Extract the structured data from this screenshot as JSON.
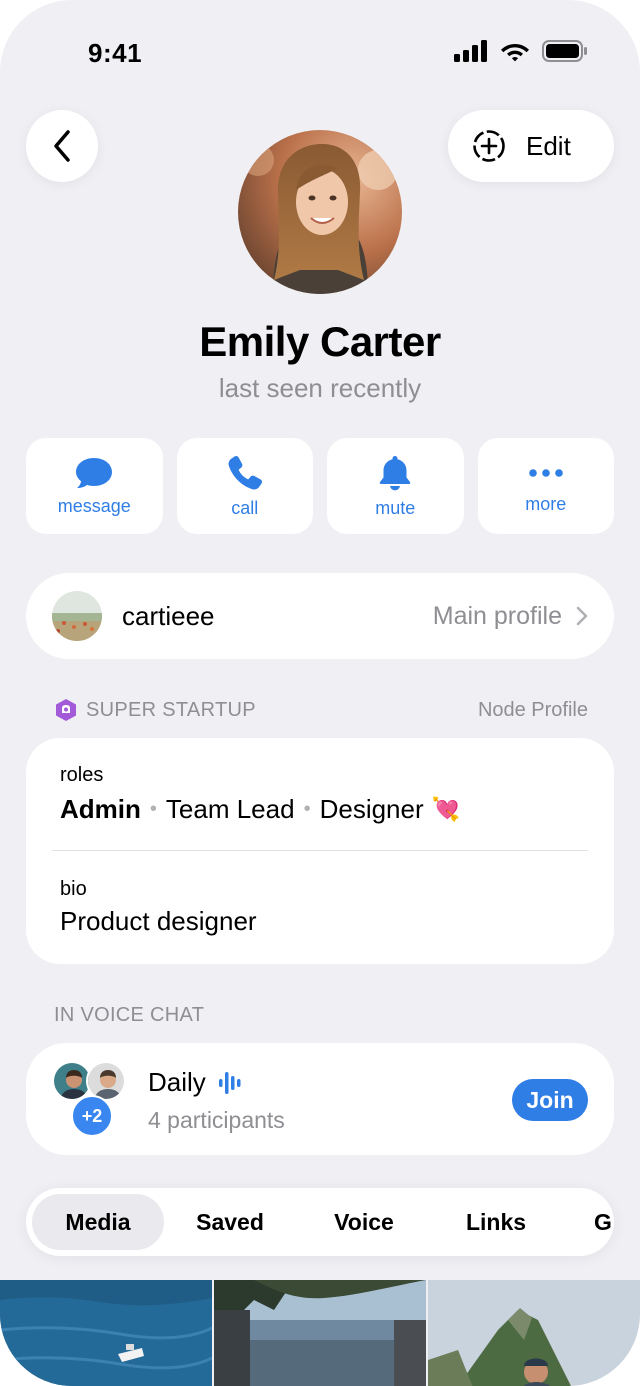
{
  "status_bar": {
    "time": "9:41"
  },
  "header": {
    "edit_label": "Edit"
  },
  "profile": {
    "name": "Emily Carter",
    "status": "last seen recently"
  },
  "actions": [
    {
      "label": "message",
      "icon": "message-bubble-icon"
    },
    {
      "label": "call",
      "icon": "phone-icon"
    },
    {
      "label": "mute",
      "icon": "bell-icon"
    },
    {
      "label": "more",
      "icon": "ellipsis-icon"
    }
  ],
  "main_profile": {
    "username": "cartieee",
    "label": "Main profile"
  },
  "organization": {
    "name": "SUPER STARTUP",
    "link": "Node Profile",
    "roles_label": "roles",
    "roles": [
      "Admin",
      "Team Lead",
      "Designer"
    ],
    "roles_emoji": "💘",
    "bio_label": "bio",
    "bio": "Product designer"
  },
  "voice_chat": {
    "section_title": "IN VOICE CHAT",
    "title": "Daily",
    "participants": "4 participants",
    "extra_count": "+2",
    "join_label": "Join"
  },
  "tabs": [
    "Media",
    "Saved",
    "Voice",
    "Links",
    "G"
  ],
  "active_tab": "Media",
  "colors": {
    "accent": "#2f7ee6",
    "background": "#efeff4",
    "secondary_text": "#8e8e93"
  }
}
